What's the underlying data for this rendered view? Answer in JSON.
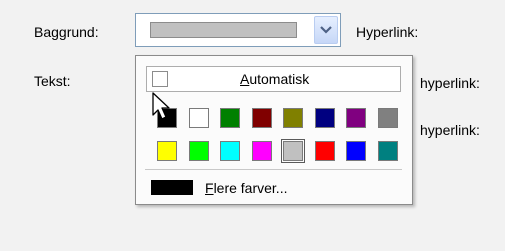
{
  "labels": {
    "background": "Baggrund:",
    "text": "Tekst:",
    "hyperlink": "Hyperlink:",
    "hyperlink2": "hyperlink:",
    "hyperlink3": "hyperlink:"
  },
  "background_select": {
    "value_color": "#c0c0c0",
    "arrow_icon": "chevron-down-icon"
  },
  "palette": {
    "automatic_prefix": "",
    "automatic_underlined": "A",
    "automatic_rest": "utomatisk",
    "more_prefix": "F",
    "more_rest": "lere farver...",
    "more_color": "#000000",
    "selected_color": "#c0c0c0",
    "rows": [
      [
        "#000000",
        "#ffffff",
        "#008000",
        "#800000",
        "#808000",
        "#000080",
        "#800080",
        "#808080"
      ],
      [
        "#ffff00",
        "#00ff00",
        "#00ffff",
        "#ff00ff",
        "#c0c0c0",
        "#ff0000",
        "#0000ff",
        "#008080"
      ]
    ]
  }
}
